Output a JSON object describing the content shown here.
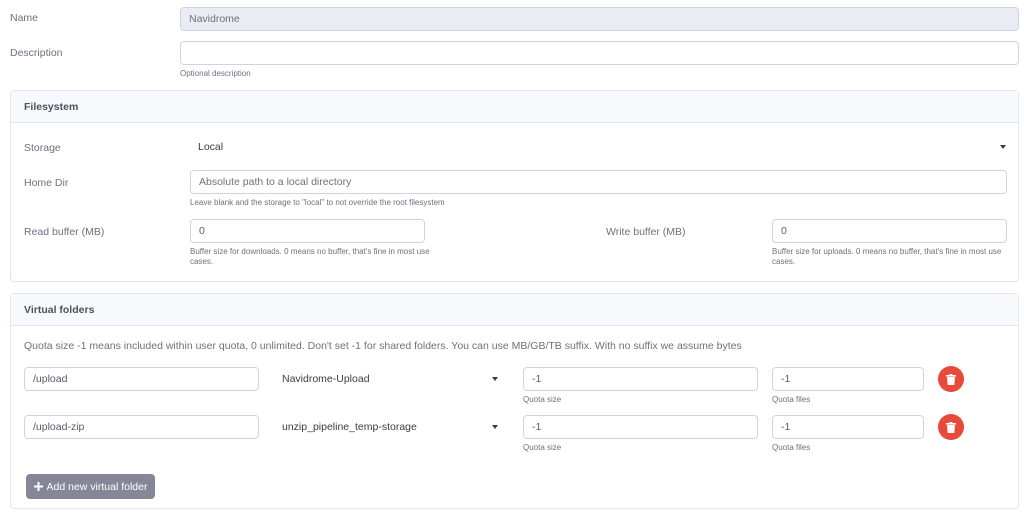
{
  "name": {
    "label": "Name",
    "value": "Navidrome"
  },
  "description": {
    "label": "Description",
    "value": "",
    "help": "Optional description"
  },
  "filesystem": {
    "title": "Filesystem",
    "storage": {
      "label": "Storage",
      "value": "Local"
    },
    "home_dir": {
      "label": "Home Dir",
      "placeholder": "Absolute path to a local directory",
      "help": "Leave blank and the storage to \"local\" to not override the root filesystem"
    },
    "read_buffer": {
      "label": "Read buffer (MB)",
      "value": "0",
      "help": "Buffer size for downloads. 0 means no buffer, that's fine in most use cases."
    },
    "write_buffer": {
      "label": "Write buffer (MB)",
      "value": "0",
      "help": "Buffer size for uploads. 0 means no buffer, that's fine in most use cases."
    }
  },
  "virtual_folders": {
    "title": "Virtual folders",
    "note": "Quota size -1 means included within user quota, 0 unlimited. Don't set -1 for shared folders. You can use MB/GB/TB suffix. With no suffix we assume bytes",
    "rows": [
      {
        "path": "/upload",
        "folder": "Navidrome-Upload",
        "quota_size": "-1",
        "quota_size_label": "Quota size",
        "quota_files": "-1",
        "quota_files_label": "Quota files"
      },
      {
        "path": "/upload-zip",
        "folder": "unzip_pipeline_temp-storage",
        "quota_size": "-1",
        "quota_size_label": "Quota size",
        "quota_files": "-1",
        "quota_files_label": "Quota files"
      }
    ],
    "add_button": "Add new virtual folder"
  },
  "icons": {
    "delete": "trash-icon",
    "add": "plus-icon",
    "dropdown": "caret-down-icon"
  },
  "colors": {
    "danger": "#e74a3b",
    "secondary": "#858796",
    "border": "#e3e6f0"
  }
}
